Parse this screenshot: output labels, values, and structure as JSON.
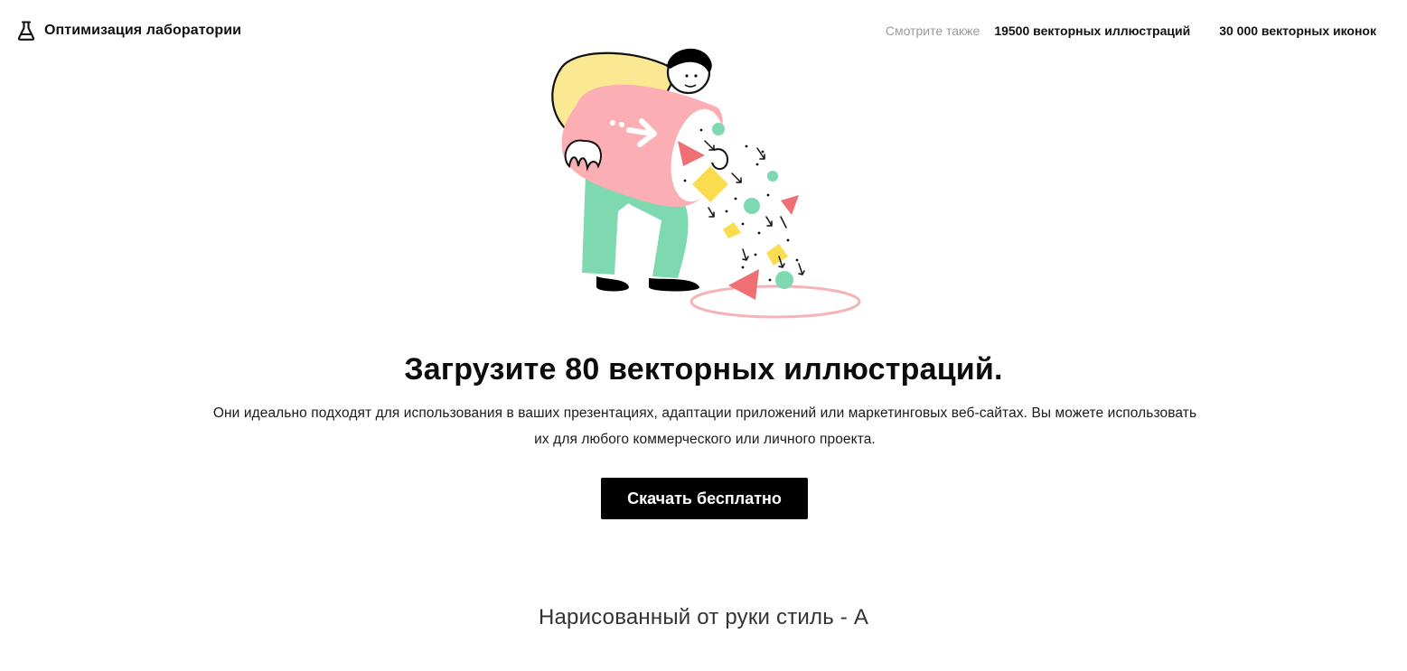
{
  "header": {
    "brand_label": "Оптимизация лаборатории",
    "brand_icon": "flask-icon",
    "see_also_label": "Смотрите также",
    "links": [
      {
        "label": "19500 векторных иллюстраций"
      },
      {
        "label": "30 000 векторных иконок"
      }
    ]
  },
  "hero": {
    "illustration": "person-pouring-shapes-illustration",
    "title": "Загрузите 80 векторных иллюстраций.",
    "description": "Они идеально подходят для использования в ваших презентациях, адаптации приложений или маркетинговых веб-сайтах. Вы можете использовать их для любого коммерческого или личного проекта.",
    "download_button_label": "Скачать бесплатно"
  },
  "section": {
    "heading": "Нарисованный от руки стиль - А"
  },
  "colors": {
    "pink": "#FBAFB5",
    "yellow": "#FBE892",
    "green": "#7ED8B0",
    "red": "#EF6F73",
    "shape_yellow": "#FCDC4F",
    "black": "#000000"
  }
}
